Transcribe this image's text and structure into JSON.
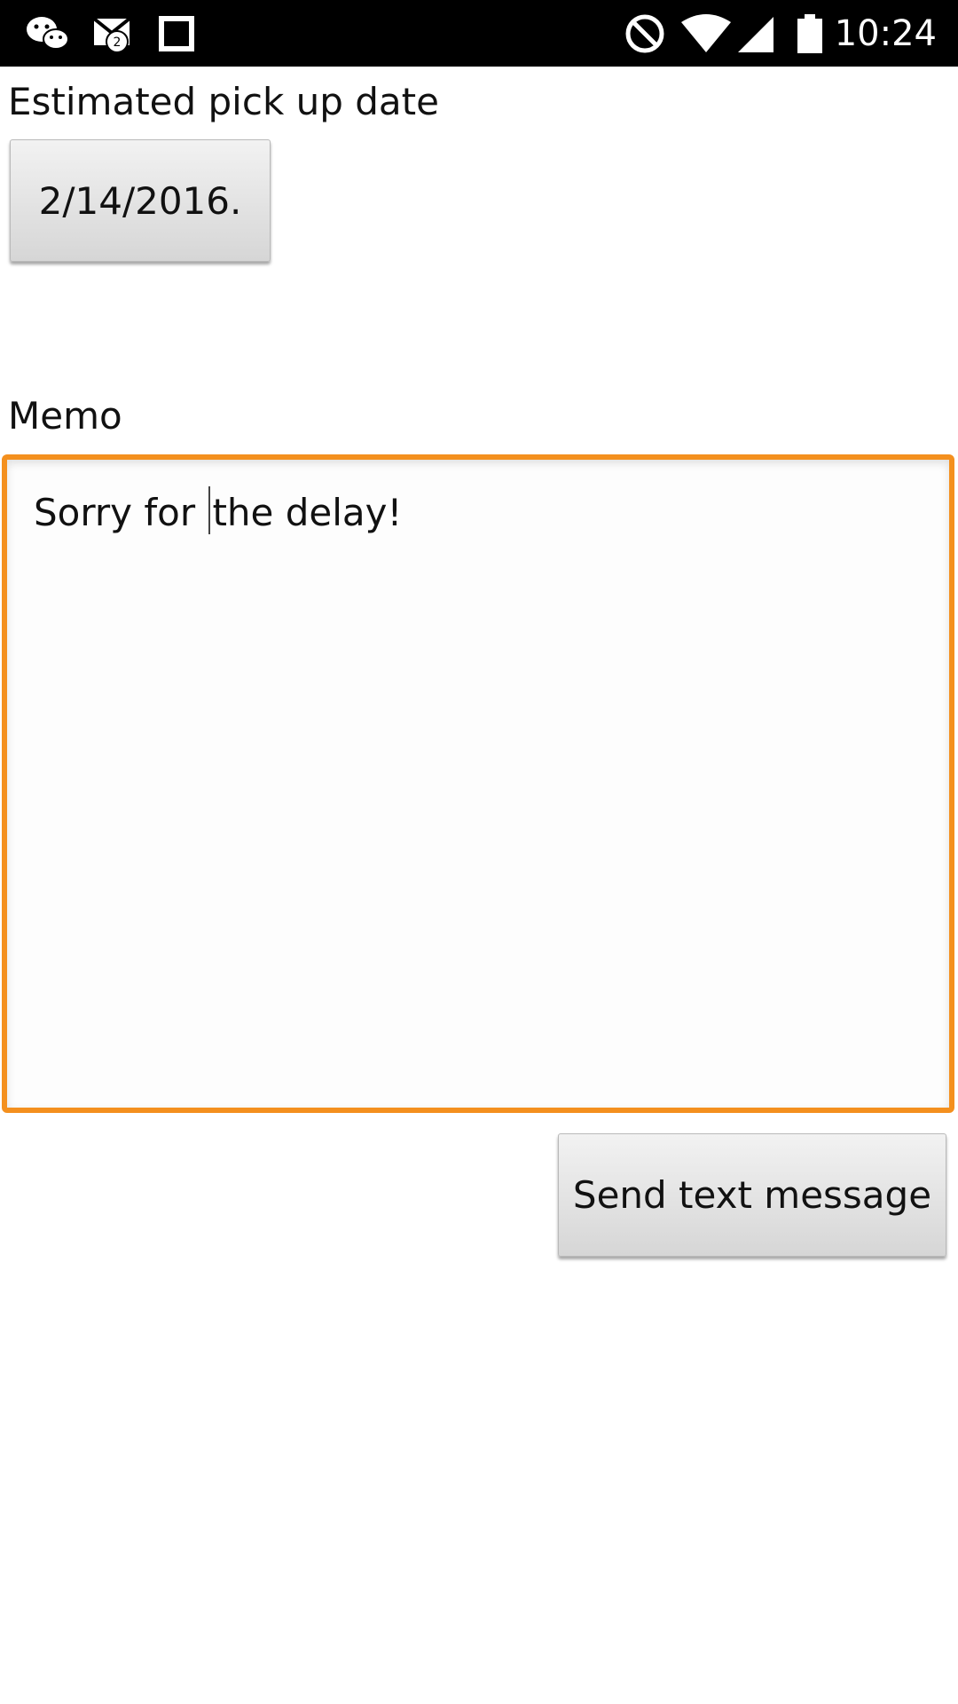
{
  "status_bar": {
    "time": "10:24",
    "notification_badge": "2",
    "icons": [
      "wechat-icon",
      "gmail-icon",
      "square-icon",
      "do-not-disturb-icon",
      "wifi-icon",
      "cell-signal-icon",
      "battery-icon"
    ]
  },
  "pickup": {
    "label": "Estimated pick up date",
    "date_value": "2/14/2016."
  },
  "memo": {
    "label": "Memo",
    "text_before_caret": "Sorry for ",
    "text_after_caret": "the delay!",
    "focus_color": "#f4901e"
  },
  "actions": {
    "send_label": "Send text message"
  }
}
